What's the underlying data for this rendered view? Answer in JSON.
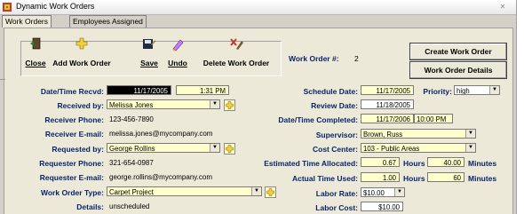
{
  "window": {
    "title": "Dynamic Work Orders"
  },
  "tabs": [
    {
      "label": "Work Orders"
    },
    {
      "label": "Employees Assigned"
    }
  ],
  "toolbar": {
    "close": "Close",
    "add_work_order": "Add Work Order",
    "save": "Save",
    "undo": "Undo",
    "delete_work_order": "Delete Work Order"
  },
  "work_order": {
    "label": "Work Order #:",
    "number": "2"
  },
  "actions": {
    "create": "Create Work Order",
    "details": "Work Order Details"
  },
  "left": {
    "date_received": {
      "label": "Date/Time Recvd:",
      "date": "11/17/2005",
      "time": "1:31 PM"
    },
    "received_by": {
      "label": "Received by:",
      "value": "Melissa Jones"
    },
    "receiver_phone": {
      "label": "Receiver Phone:",
      "value": "123-456-7890"
    },
    "receiver_email": {
      "label": "Receiver E-mail:",
      "value": "melissa.jones@mycompany.com"
    },
    "requested_by": {
      "label": "Requested by:",
      "value": "George Rollins"
    },
    "requester_phone": {
      "label": "Requester Phone:",
      "value": "321-654-0987"
    },
    "requester_email": {
      "label": "Requester E-mail:",
      "value": "george.rollins@mycompany.com"
    },
    "work_order_type": {
      "label": "Work Order Type:",
      "value": "Carpet Project"
    },
    "details": {
      "label": "Details:",
      "value": "unscheduled"
    }
  },
  "right": {
    "schedule_date": {
      "label": "Schedule Date:",
      "value": "11/17/2005"
    },
    "priority": {
      "label": "Priority:",
      "value": "high"
    },
    "review_date": {
      "label": "Review Date:",
      "value": "11/18/2005"
    },
    "completed": {
      "label": "Date/Time Completed:",
      "date": "11/17/2006",
      "time": "10:00 PM"
    },
    "supervisor": {
      "label": "Supervisor:",
      "value": "Brown, Russ"
    },
    "cost_center": {
      "label": "Cost Center:",
      "value": "103 - Public Areas"
    },
    "est_time": {
      "label": "Estimated Time Allocated:",
      "hours": "0.67",
      "minutes": "40.00"
    },
    "actual_time": {
      "label": "Actual Time Used:",
      "hours": "1.00",
      "minutes": "60"
    },
    "labor_rate": {
      "label": "Labor Rate:",
      "value": "$10.00"
    },
    "labor_cost": {
      "label": "Labor Cost:",
      "value": "$10.00"
    },
    "hours_unit": "Hours",
    "minutes_unit": "Minutes"
  },
  "colors": {
    "label_blue": "#0a246a",
    "field_yellow": "#ffffcc",
    "panel": "#ece9d8"
  }
}
